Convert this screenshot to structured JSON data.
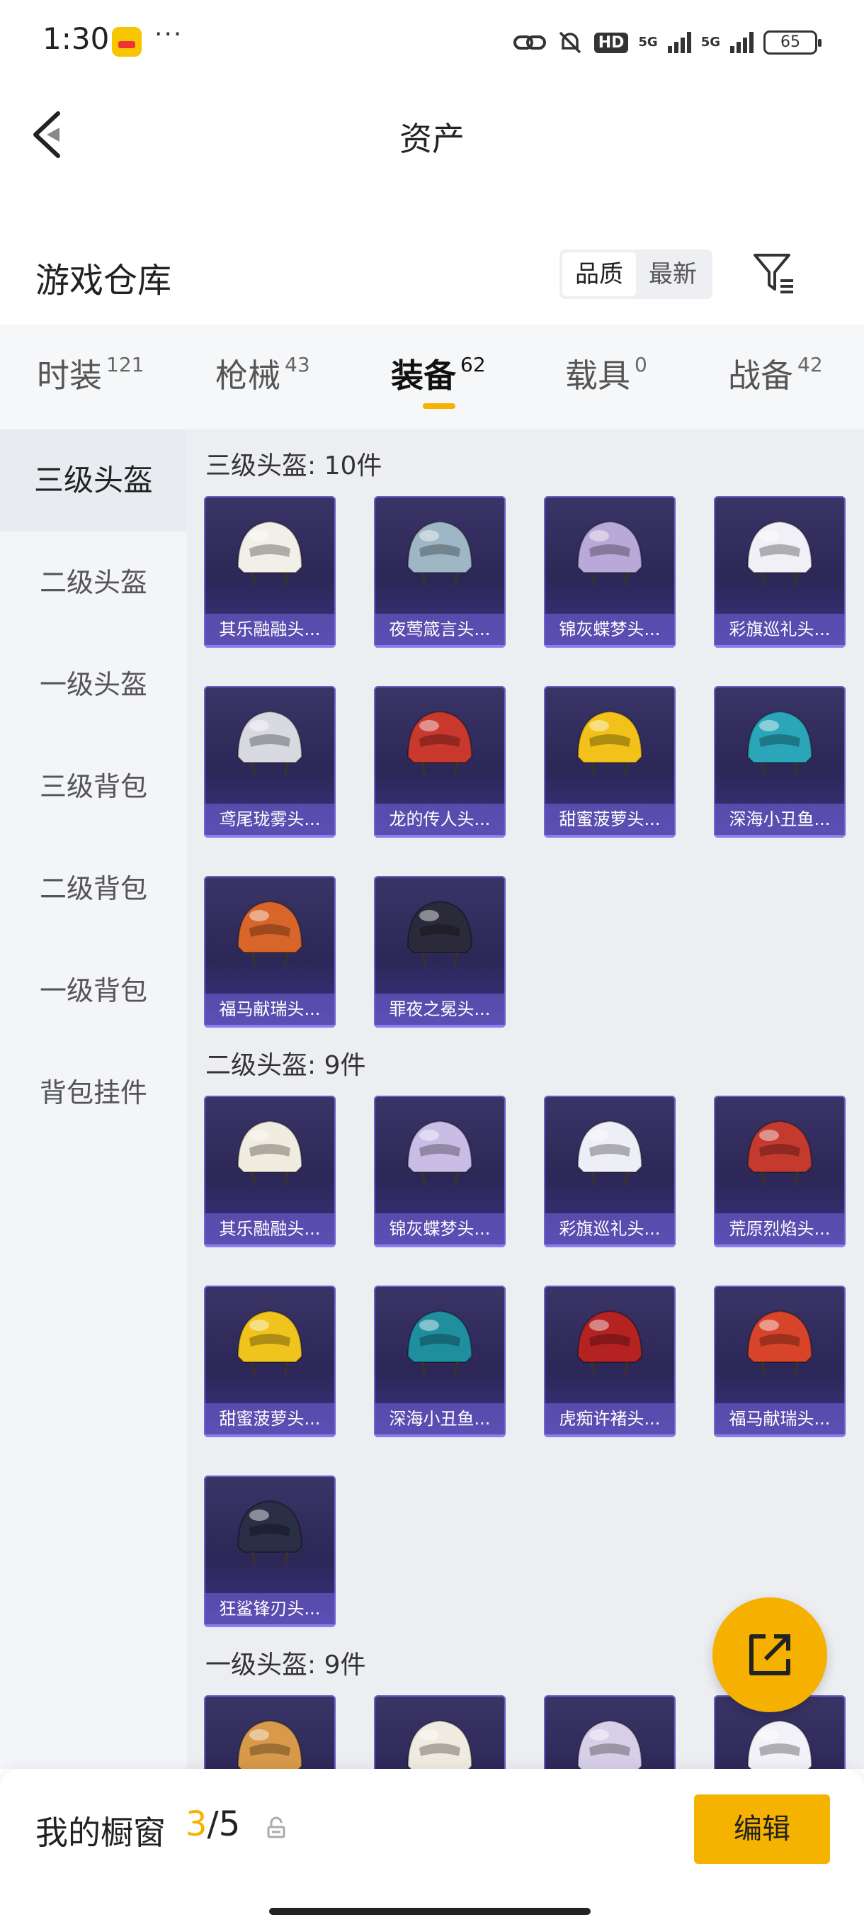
{
  "status_bar": {
    "time": "1:30",
    "dots": "···",
    "hd": "HD",
    "net1": "5G",
    "net2": "5G",
    "battery": "65"
  },
  "nav": {
    "title": "资产",
    "back_icon": "chevron-left-icon"
  },
  "header": {
    "title": "游戏仓库",
    "sort_options": [
      "品质",
      "最新"
    ],
    "sort_selected": "品质",
    "filter_icon": "filter-icon"
  },
  "tabs": [
    {
      "label": "时装",
      "count": "121"
    },
    {
      "label": "枪械",
      "count": "43"
    },
    {
      "label": "装备",
      "count": "62",
      "active": true
    },
    {
      "label": "载具",
      "count": "0"
    },
    {
      "label": "战备",
      "count": "42"
    }
  ],
  "sidebar": {
    "items": [
      "三级头盔",
      "二级头盔",
      "一级头盔",
      "三级背包",
      "二级背包",
      "一级背包",
      "背包挂件"
    ],
    "selected": "三级头盔"
  },
  "sections": [
    {
      "title": "三级头盔: 10件",
      "items": [
        "其乐融融头...",
        "夜莺箴言头...",
        "锦灰蝶梦头...",
        "彩旗巡礼头...",
        "鸢尾珑雾头...",
        "龙的传人头...",
        "甜蜜菠萝头...",
        "深海小丑鱼...",
        "福马献瑞头...",
        "罪夜之冕头..."
      ]
    },
    {
      "title": "二级头盔: 9件",
      "items": [
        "其乐融融头...",
        "锦灰蝶梦头...",
        "彩旗巡礼头...",
        "荒原烈焰头...",
        "甜蜜菠萝头...",
        "深海小丑鱼...",
        "虎痴许褚头...",
        "福马献瑞头...",
        "狂鲨锋刃头..."
      ]
    },
    {
      "title": "一级头盔: 9件",
      "items": [
        "",
        "",
        "",
        ""
      ]
    }
  ],
  "helmet_colors": {
    "three": [
      "#f2efe8",
      "#9fb7c4",
      "#b9a9d8",
      "#f1f0f6",
      "#d9d9e2",
      "#c8382d",
      "#f2c21a",
      "#2aa6b8",
      "#d8662a",
      "#2b2a3a"
    ],
    "two": [
      "#f1ece0",
      "#c9bde6",
      "#eeeef6",
      "#c43a2e",
      "#f0c41c",
      "#1f8fa0",
      "#b52222",
      "#d8442a",
      "#2a2f46"
    ],
    "one": [
      "#d89a4a",
      "#f0ebe0",
      "#d7cfe8",
      "#f2f2f8"
    ]
  },
  "bottom_bar": {
    "label": "我的橱窗",
    "current": "3",
    "total": "/5",
    "lock_icon": "lock-icon",
    "edit_label": "编辑"
  },
  "fab": {
    "icon": "share-external-icon"
  },
  "accent_color": "#f5b300"
}
